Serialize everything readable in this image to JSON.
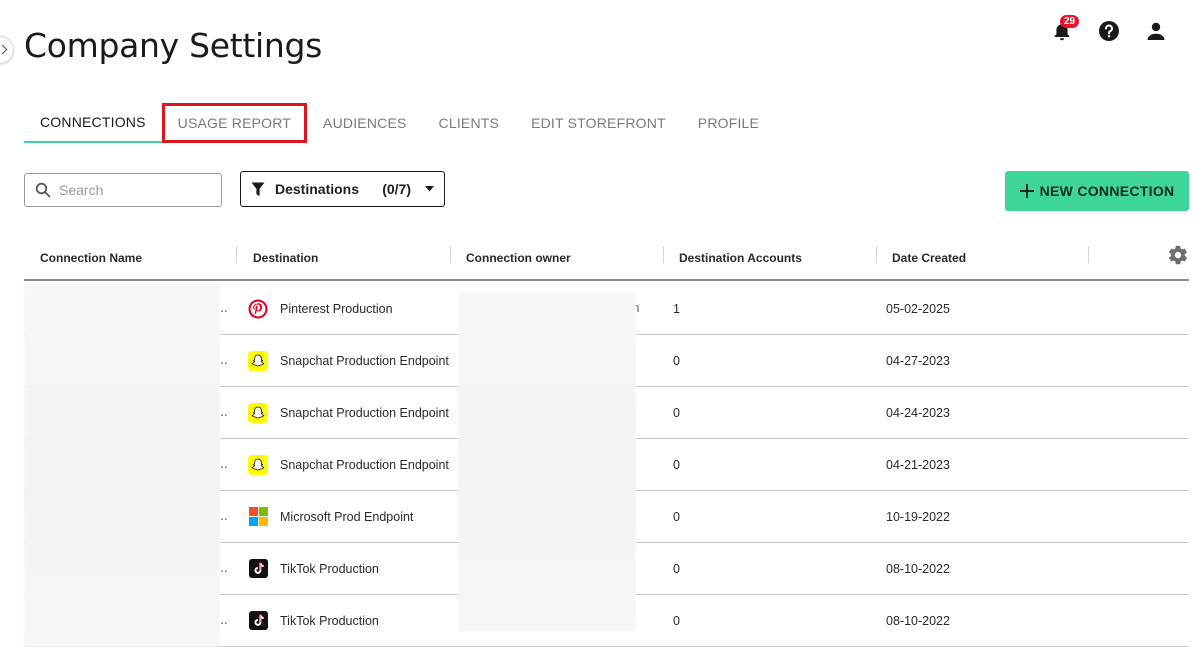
{
  "header": {
    "title": "Company Settings",
    "notification_count": "29"
  },
  "tabs": [
    {
      "label": "CONNECTIONS",
      "active": true
    },
    {
      "label": "USAGE REPORT",
      "highlighted": true
    },
    {
      "label": "AUDIENCES"
    },
    {
      "label": "CLIENTS"
    },
    {
      "label": "EDIT STOREFRONT"
    },
    {
      "label": "PROFILE"
    }
  ],
  "toolbar": {
    "search_placeholder": "Search",
    "filter_label": "Destinations",
    "filter_count": "(0/7)",
    "new_connection_label": "NEW CONNECTION"
  },
  "table": {
    "columns": [
      "Connection Name",
      "Destination",
      "Connection owner",
      "Destination Accounts",
      "Date Created"
    ],
    "rows": [
      {
        "destination": "Pinterest Production",
        "icon": "pinterest-icon",
        "accounts": "1",
        "date": "05-02-2025"
      },
      {
        "destination": "Snapchat Production Endpoint",
        "icon": "snapchat-icon",
        "accounts": "0",
        "date": "04-27-2023"
      },
      {
        "destination": "Snapchat Production Endpoint",
        "icon": "snapchat-icon",
        "accounts": "0",
        "date": "04-24-2023"
      },
      {
        "destination": "Snapchat Production Endpoint",
        "icon": "snapchat-icon",
        "accounts": "0",
        "date": "04-21-2023"
      },
      {
        "destination": "Microsoft Prod Endpoint",
        "icon": "microsoft-icon",
        "accounts": "0",
        "date": "10-19-2022"
      },
      {
        "destination": "TikTok Production",
        "icon": "tiktok-icon",
        "accounts": "0",
        "date": "08-10-2022"
      },
      {
        "destination": "TikTok Production",
        "icon": "tiktok-icon",
        "accounts": "0",
        "date": "08-10-2022"
      }
    ]
  },
  "colors": {
    "accent": "#3dd598",
    "highlight_box": "#e0141e",
    "badge": "#e5142d"
  }
}
